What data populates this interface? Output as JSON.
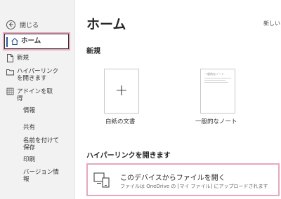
{
  "sidebar": {
    "back_label": "閉じる",
    "items": [
      {
        "label": "ホーム"
      },
      {
        "label": "新規"
      },
      {
        "label_lines": [
          "ハイパーリンク",
          "を開きます"
        ]
      },
      {
        "label_lines": [
          "アドインを取",
          "得"
        ]
      }
    ],
    "plain_items": [
      {
        "label": "情報"
      },
      {
        "label": "共有"
      },
      {
        "label_lines": [
          "名前を付けて",
          "保存"
        ]
      },
      {
        "label": "印刷"
      },
      {
        "label_lines": [
          "バージョン情",
          "報"
        ]
      }
    ]
  },
  "main": {
    "title": "ホーム",
    "new_link": "新しい",
    "section_new": "新規",
    "tiles": [
      {
        "label": "白紙の文書"
      },
      {
        "label": "一般的なノート",
        "preview_title": "一般的なノート"
      }
    ],
    "section_hyperlink": "ハイパーリンクを開きます",
    "device_card": {
      "title": "このデバイスからファイルを開く",
      "subtitle": "ファイルは OneDrive の [マイ ファイル] にアップロードされます"
    }
  },
  "colors": {
    "accent": "#2b579a",
    "highlight": "#e8a7bd",
    "sidebar_bg": "#f2f2f2"
  }
}
